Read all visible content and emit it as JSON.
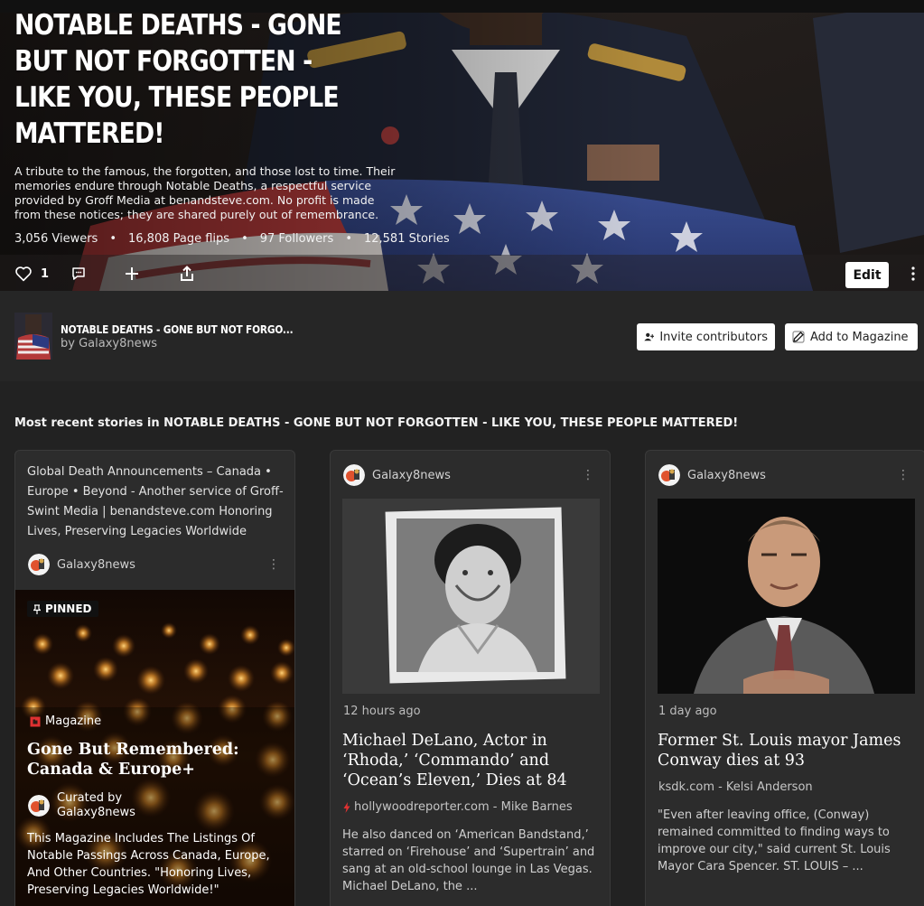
{
  "hero": {
    "title": "NOTABLE DEATHS - GONE BUT NOT FORGOTTEN - LIKE YOU, THESE PEOPLE MATTERED!",
    "description": "A tribute to the famous, the forgotten, and those lost to time. Their memories endure through Notable Deaths, a respectful service provided by Groff Media at benandsteve.com. No profit is made from these notices; they are shared purely out of remembrance.",
    "stats": [
      "3,056 Viewers",
      "16,808 Page flips",
      "97 Followers",
      "12,581 Stories"
    ],
    "like_count": "1",
    "edit_label": "Edit"
  },
  "magazine_bar": {
    "name": "NOTABLE DEATHS - GONE BUT NOT FORGO...",
    "byline": "by Galaxy8news",
    "invite_label": "Invite contributors",
    "add_label": "Add to Magazine"
  },
  "section": {
    "title": "Most recent stories in NOTABLE DEATHS - GONE BUT NOT FORGOTTEN - LIKE YOU, THESE PEOPLE MATTERED!"
  },
  "cards": [
    {
      "intro": "Global Death Announcements – Canada • Europe • Beyond - Another service of Groff-Swint Media | benandsteve.com Honoring Lives, Preserving Legacies Worldwide",
      "author": "Galaxy8news",
      "pinned": "PINNED",
      "type_label": "Magazine",
      "headline": "Gone But Remembered: Canada & Europe+",
      "curated_label": "Curated by",
      "curated_by": "Galaxy8news",
      "excerpt": "This Magazine Includes The Listings Of Notable Passings Across Canada, Europe, And Other Countries. \"Honoring Lives, Preserving Legacies Worldwide!\""
    },
    {
      "author": "Galaxy8news",
      "time": "12 hours ago",
      "headline": "Michael DeLano, Actor in ‘Rhoda,’ ‘Commando’ and ‘Ocean’s Eleven,’ Dies at 84",
      "source": "hollywoodreporter.com - Mike Barnes",
      "excerpt": "He also danced on ‘American Bandstand,’ starred on ‘Firehouse’ and ‘Supertrain’ and sang at an old-school lounge in Las Vegas. Michael DeLano, the ..."
    },
    {
      "author": "Galaxy8news",
      "time": "1 day ago",
      "headline": "Former St. Louis mayor James Conway dies at 93",
      "source": "ksdk.com - Kelsi Anderson",
      "excerpt": "\"Even after leaving office, (Conway) remained committed to finding ways to improve our city,\" said current St. Louis Mayor Cara Spencer. ST. LOUIS – ..."
    }
  ],
  "colors": {
    "background": "#222222",
    "card": "#2c2c2c",
    "accent_red": "#e03131",
    "text": "#ffffff"
  },
  "icons": [
    "heart-icon",
    "comment-icon",
    "plus-icon",
    "share-icon",
    "more-vertical-icon",
    "add-person-icon",
    "edit-pencil-icon",
    "pin-icon",
    "magazine-icon",
    "flash-icon"
  ]
}
